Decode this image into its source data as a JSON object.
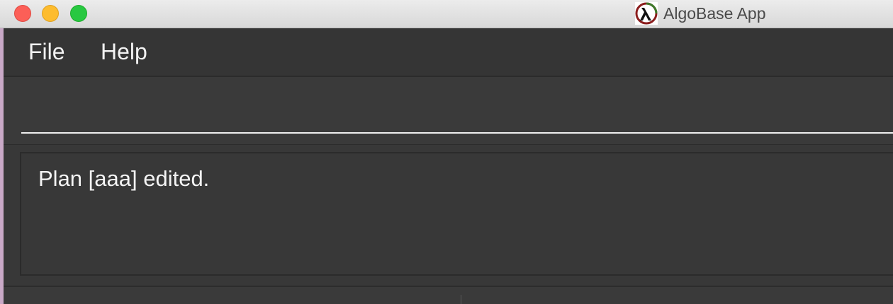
{
  "window": {
    "title": "AlgoBase App",
    "logo_icon": "lambda-icon"
  },
  "menubar": {
    "items": [
      {
        "label": "File"
      },
      {
        "label": "Help"
      }
    ]
  },
  "command_box": {
    "value": "",
    "placeholder": ""
  },
  "result_display": {
    "text": "Plan [aaa] edited."
  },
  "colors": {
    "background": "#383838",
    "menubar": "#353535",
    "text": "#f2f2f2",
    "close": "#fc5f57",
    "minimize": "#fdbc2e",
    "maximize": "#28c841"
  }
}
